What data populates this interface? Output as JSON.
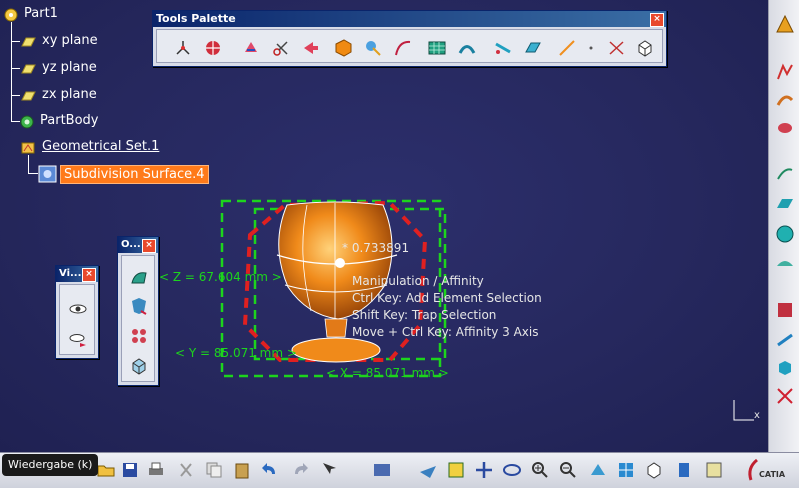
{
  "tree": {
    "root": "Part1",
    "items": [
      {
        "label": "xy plane"
      },
      {
        "label": "yz plane"
      },
      {
        "label": "zx plane"
      },
      {
        "label": "PartBody"
      },
      {
        "label": "Geometrical Set.1"
      },
      {
        "label": "Subdivision Surface.4"
      }
    ]
  },
  "tools_palette": {
    "title": "Tools Palette",
    "close": "×",
    "icons": [
      "axis-icon",
      "compass-icon",
      "rotate-icon",
      "scissors-icon",
      "arrow-shape-icon",
      "orange-solid-icon",
      "node-icon",
      "curve-icon",
      "grid-surface-icon",
      "arc-icon",
      "slash-icon",
      "blue-sheet-icon",
      "line-icon",
      "dot-icon",
      "dimension-icon",
      "cube-icon"
    ]
  },
  "mini_palette_vi": {
    "title": "Vi...",
    "close": "×"
  },
  "mini_palette_o": {
    "title": "O...",
    "close": "×"
  },
  "viewport": {
    "dim_z": "< Z = 67.604 mm >",
    "dim_y": "< Y = 85.071 mm >",
    "dim_x": "< X = 85.071 mm >",
    "coef": "* 0.733891",
    "hint_lines": [
      "Manipulation / Affinity",
      "Ctrl Key: Add Element Selection",
      "Shift Key: Trap Selection",
      "Move + Ctrl Key: Affinity 3 Axis"
    ],
    "axis_label": "x"
  },
  "tooltip": "Wiedergabe (k)",
  "brand": "CATIA",
  "colors": {
    "background": "#26285e",
    "selection": "#ff7a1a",
    "dimension_green": "#1dd41d",
    "surface_orange": "#e8791a"
  }
}
